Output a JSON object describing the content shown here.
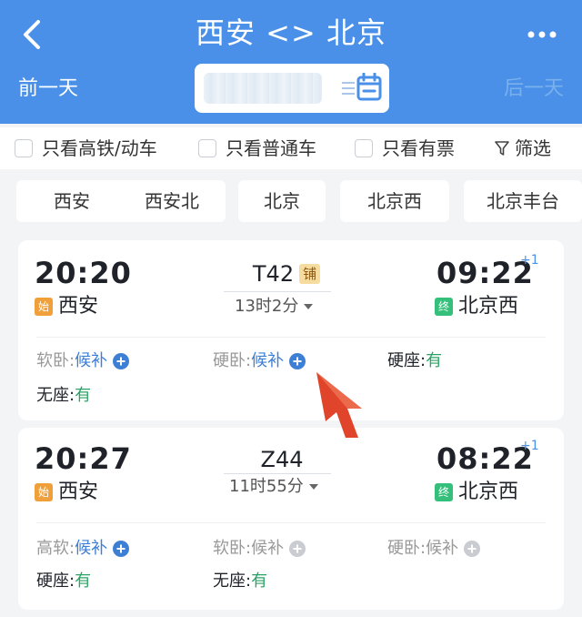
{
  "header": {
    "title": "西安 <> 北京",
    "prev_day": "前一天",
    "next_day": "后一天"
  },
  "filters": [
    {
      "label": "只看高铁/动车",
      "checked": false
    },
    {
      "label": "只看普通车",
      "checked": false
    },
    {
      "label": "只看有票",
      "checked": false
    },
    {
      "label": "筛选"
    }
  ],
  "stations": [
    "西安",
    "西安北",
    "北京",
    "北京西",
    "北京丰台"
  ],
  "trains": [
    {
      "depart_time": "20:20",
      "depart_badge": "始",
      "depart_station": "西安",
      "train_no": "T42",
      "bunk_badge": "铺",
      "duration": "13时2分",
      "arrive_time": "09:22",
      "plus_day": "+1",
      "arrive_badge": "终",
      "arrive_station": "北京西",
      "seats": [
        {
          "label": "软卧:",
          "value": "候补",
          "status": "waitlist"
        },
        {
          "label": "硬卧:",
          "value": "候补",
          "status": "waitlist"
        },
        {
          "label": "硬座:",
          "value": "有",
          "status": "available"
        },
        {
          "label": "无座:",
          "value": "有",
          "status": "available"
        }
      ]
    },
    {
      "depart_time": "20:27",
      "depart_badge": "始",
      "depart_station": "西安",
      "train_no": "Z44",
      "duration": "11时55分",
      "arrive_time": "08:22",
      "plus_day": "+1",
      "arrive_badge": "终",
      "arrive_station": "北京西",
      "seats": [
        {
          "label": "高软:",
          "value": "候补",
          "status": "waitlist"
        },
        {
          "label": "软卧:",
          "value": "候补",
          "status": "disabled"
        },
        {
          "label": "硬卧:",
          "value": "候补",
          "status": "disabled"
        },
        {
          "label": "硬座:",
          "value": "有",
          "status": "available"
        },
        {
          "label": "无座:",
          "value": "有",
          "status": "available"
        }
      ]
    }
  ],
  "colors": {
    "header_bg": "#4a90e8",
    "page_bg": "#f3f4f6",
    "waitlist_blue": "#3e7fd6",
    "available_green": "#2ba265",
    "start_badge": "#f0a03a",
    "end_badge": "#34c07a",
    "annotation_arrow": "#e0452c"
  },
  "icons": [
    "back-arrow-icon",
    "more-dots-icon",
    "calendar-icon",
    "filter-funnel-icon",
    "plus-circle-icon",
    "annotation-arrow-icon"
  ]
}
